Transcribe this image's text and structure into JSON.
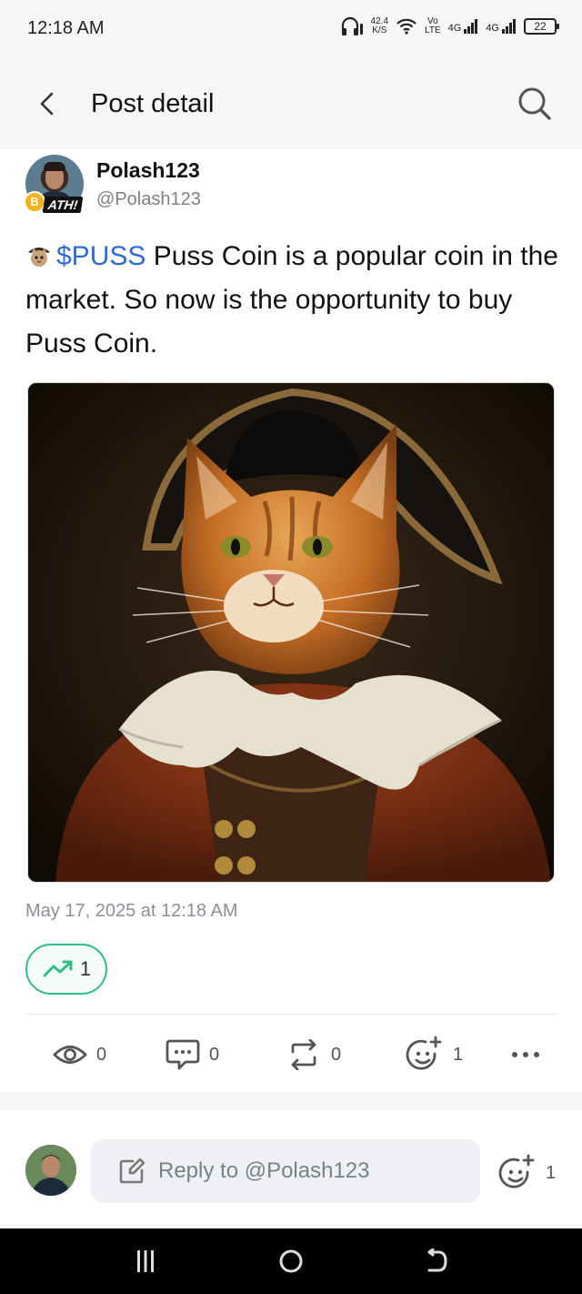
{
  "status_bar": {
    "time": "12:18 AM",
    "net_speed_value": "42.4",
    "net_speed_unit": "K/S",
    "volte_top": "Vo",
    "volte_bottom": "LTE",
    "sim1": "4G",
    "sim2": "4G",
    "battery": "22"
  },
  "header": {
    "title": "Post detail",
    "back_icon": "chevron-left-icon",
    "search_icon": "search-icon"
  },
  "post": {
    "author_name": "Polash123",
    "author_handle": "@Polash123",
    "badge_text": "ATH!",
    "coin_badge": "B",
    "ticker": "$PUSS",
    "text": " Puss Coin is a popular coin in the market. So now is the opportunity to buy Puss Coin.",
    "timestamp": "May 17, 2025 at 12:18 AM",
    "trend_count": "1"
  },
  "actions": {
    "views": "0",
    "comments": "0",
    "reposts": "0",
    "reactions": "1"
  },
  "reply": {
    "placeholder": "Reply to @Polash123",
    "reaction_count": "1"
  },
  "colors": {
    "accent_blue": "#2f6bd8",
    "trend_green": "#2ebd85",
    "muted_text": "#7a7f88",
    "header_bg": "#f5f6f8"
  }
}
